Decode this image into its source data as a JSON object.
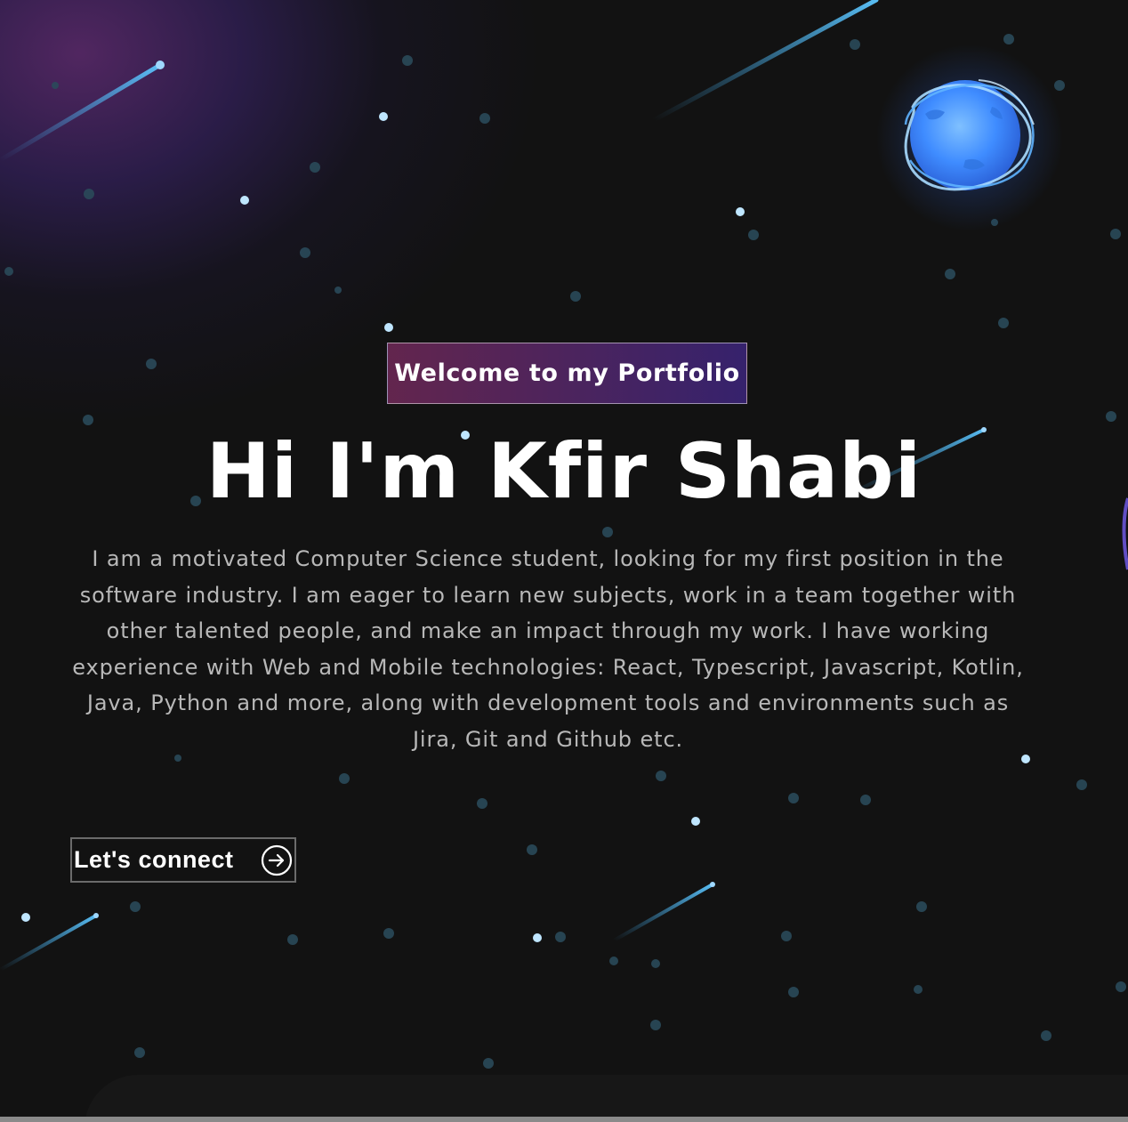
{
  "hero": {
    "tagline": "Welcome to my Portfolio",
    "headline": "Hi I'm Kfir Shabi",
    "intro": "I am a motivated Computer Science student, looking for my first position in the software industry. I am eager to learn new subjects, work in a team together with other talented people, and make an impact through my work. I have working experience with Web and Mobile technologies: React, Typescript, Javascript, Kotlin, Java, Python and more, along with development tools and environments such as Jira, Git and Github etc.",
    "cta_label": "Let's connect",
    "cta_icon": "arrow-right-circle-icon",
    "illustration": "planet-icon"
  },
  "colors": {
    "background": "#121212",
    "text": "#ffffff",
    "body_text": "#b8b8b8",
    "tagline_gradient_start": "#aa367c",
    "tagline_gradient_end": "#4a2fbd",
    "planet_glow": "#3f8cff",
    "star": "#bfe6ff"
  }
}
